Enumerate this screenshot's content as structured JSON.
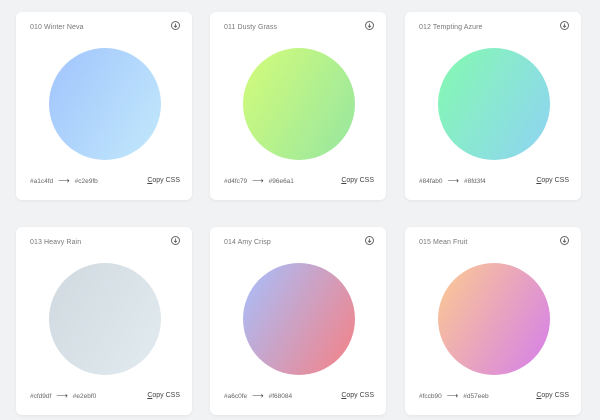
{
  "gradients": [
    {
      "name": "010 Winter Neva",
      "from": "#a1c4fd",
      "to": "#c2e9fb",
      "from_label": "#a1c4fd",
      "to_label": "#c2e9fb",
      "copy_first": "C",
      "copy_rest": "opy CSS"
    },
    {
      "name": "011 Dusty Grass",
      "from": "#d4fc79",
      "to": "#96e6a1",
      "from_label": "#d4fc79",
      "to_label": "#96e6a1",
      "copy_first": "C",
      "copy_rest": "opy CSS"
    },
    {
      "name": "012 Tempting Azure",
      "from": "#84fab0",
      "to": "#8fd3f4",
      "from_label": "#84fab0",
      "to_label": "#8fd3f4",
      "copy_first": "C",
      "copy_rest": "opy CSS"
    },
    {
      "name": "013 Heavy Rain",
      "from": "#cfd9df",
      "to": "#e2ebf0",
      "from_label": "#cfd9df",
      "to_label": "#e2ebf0",
      "copy_first": "C",
      "copy_rest": "opy CSS"
    },
    {
      "name": "014 Amy Crisp",
      "from": "#a6c0fe",
      "to": "#f68084",
      "from_label": "#a6c0fe",
      "to_label": "#f68084",
      "copy_first": "C",
      "copy_rest": "opy CSS"
    },
    {
      "name": "015 Mean Fruit",
      "from": "#fccb90",
      "to": "#d57eeb",
      "from_label": "#fccb90",
      "to_label": "#d57eeb",
      "copy_first": "C",
      "copy_rest": "opy CSS"
    }
  ],
  "icons": {
    "download": "download-icon",
    "arrow": "arrow-right-icon"
  },
  "arrow_glyph": "⟶"
}
